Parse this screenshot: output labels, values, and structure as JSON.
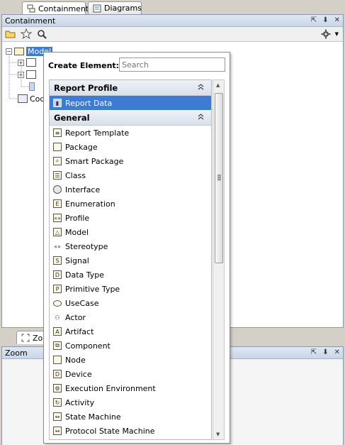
{
  "top_tabs": [
    {
      "label": "Containment",
      "icon": "containment-icon",
      "active": true
    },
    {
      "label": "Diagrams",
      "icon": "diagrams-icon",
      "active": false
    }
  ],
  "containment_panel": {
    "title": "Containment",
    "header_buttons": [
      "⇱",
      "⬇",
      "✕"
    ],
    "toolbar_icons": [
      "open-folder-icon",
      "star-icon",
      "search-icon"
    ],
    "settings_icon": "gear-icon"
  },
  "tree": {
    "root_label": "Model",
    "code_label": "Cod"
  },
  "bottom_tab": {
    "label": "Zo"
  },
  "zoom_panel": {
    "title": "Zoom",
    "header_buttons": [
      "⇱",
      "⬇",
      "✕"
    ]
  },
  "popup": {
    "label": "Create Element:",
    "search_placeholder": "Search",
    "groups": [
      {
        "name": "Report Profile",
        "items": [
          {
            "label": "Report Data",
            "icon": "report-data-icon",
            "glyph": "▮",
            "shape": "",
            "selected": true
          }
        ]
      },
      {
        "name": "General",
        "items": [
          {
            "label": "Report Template",
            "icon": "report-template-icon",
            "glyph": "≡",
            "shape": ""
          },
          {
            "label": "Package",
            "icon": "package-icon",
            "glyph": "",
            "shape": ""
          },
          {
            "label": "Smart Package",
            "icon": "smart-package-icon",
            "glyph": "⌕",
            "shape": ""
          },
          {
            "label": "Class",
            "icon": "class-icon",
            "glyph": "☰",
            "shape": ""
          },
          {
            "label": "Interface",
            "icon": "interface-icon",
            "glyph": "",
            "shape": "round"
          },
          {
            "label": "Enumeration",
            "icon": "enumeration-icon",
            "glyph": "E",
            "shape": ""
          },
          {
            "label": "Profile",
            "icon": "profile-icon",
            "glyph": "«»",
            "shape": ""
          },
          {
            "label": "Model",
            "icon": "model-icon",
            "glyph": "△",
            "shape": ""
          },
          {
            "label": "Stereotype",
            "icon": "stereotype-icon",
            "glyph": "«»",
            "shape": "none"
          },
          {
            "label": "Signal",
            "icon": "signal-icon",
            "glyph": "S",
            "shape": ""
          },
          {
            "label": "Data Type",
            "icon": "data-type-icon",
            "glyph": "D",
            "shape": ""
          },
          {
            "label": "Primitive Type",
            "icon": "primitive-type-icon",
            "glyph": "P",
            "shape": ""
          },
          {
            "label": "UseCase",
            "icon": "usecase-icon",
            "glyph": "",
            "shape": "oval"
          },
          {
            "label": "Actor",
            "icon": "actor-icon",
            "glyph": "⚇",
            "shape": "none"
          },
          {
            "label": "Artifact",
            "icon": "artifact-icon",
            "glyph": "A",
            "shape": ""
          },
          {
            "label": "Component",
            "icon": "component-icon",
            "glyph": "⧉",
            "shape": ""
          },
          {
            "label": "Node",
            "icon": "node-icon",
            "glyph": "",
            "shape": ""
          },
          {
            "label": "Device",
            "icon": "device-icon",
            "glyph": "D",
            "shape": ""
          },
          {
            "label": "Execution Environment",
            "icon": "execution-environment-icon",
            "glyph": "⚙",
            "shape": ""
          },
          {
            "label": "Activity",
            "icon": "activity-icon",
            "glyph": "↻",
            "shape": ""
          },
          {
            "label": "State Machine",
            "icon": "state-machine-icon",
            "glyph": "↔",
            "shape": ""
          },
          {
            "label": "Protocol State Machine",
            "icon": "protocol-state-machine-icon",
            "glyph": "↔",
            "shape": ""
          }
        ]
      }
    ]
  }
}
